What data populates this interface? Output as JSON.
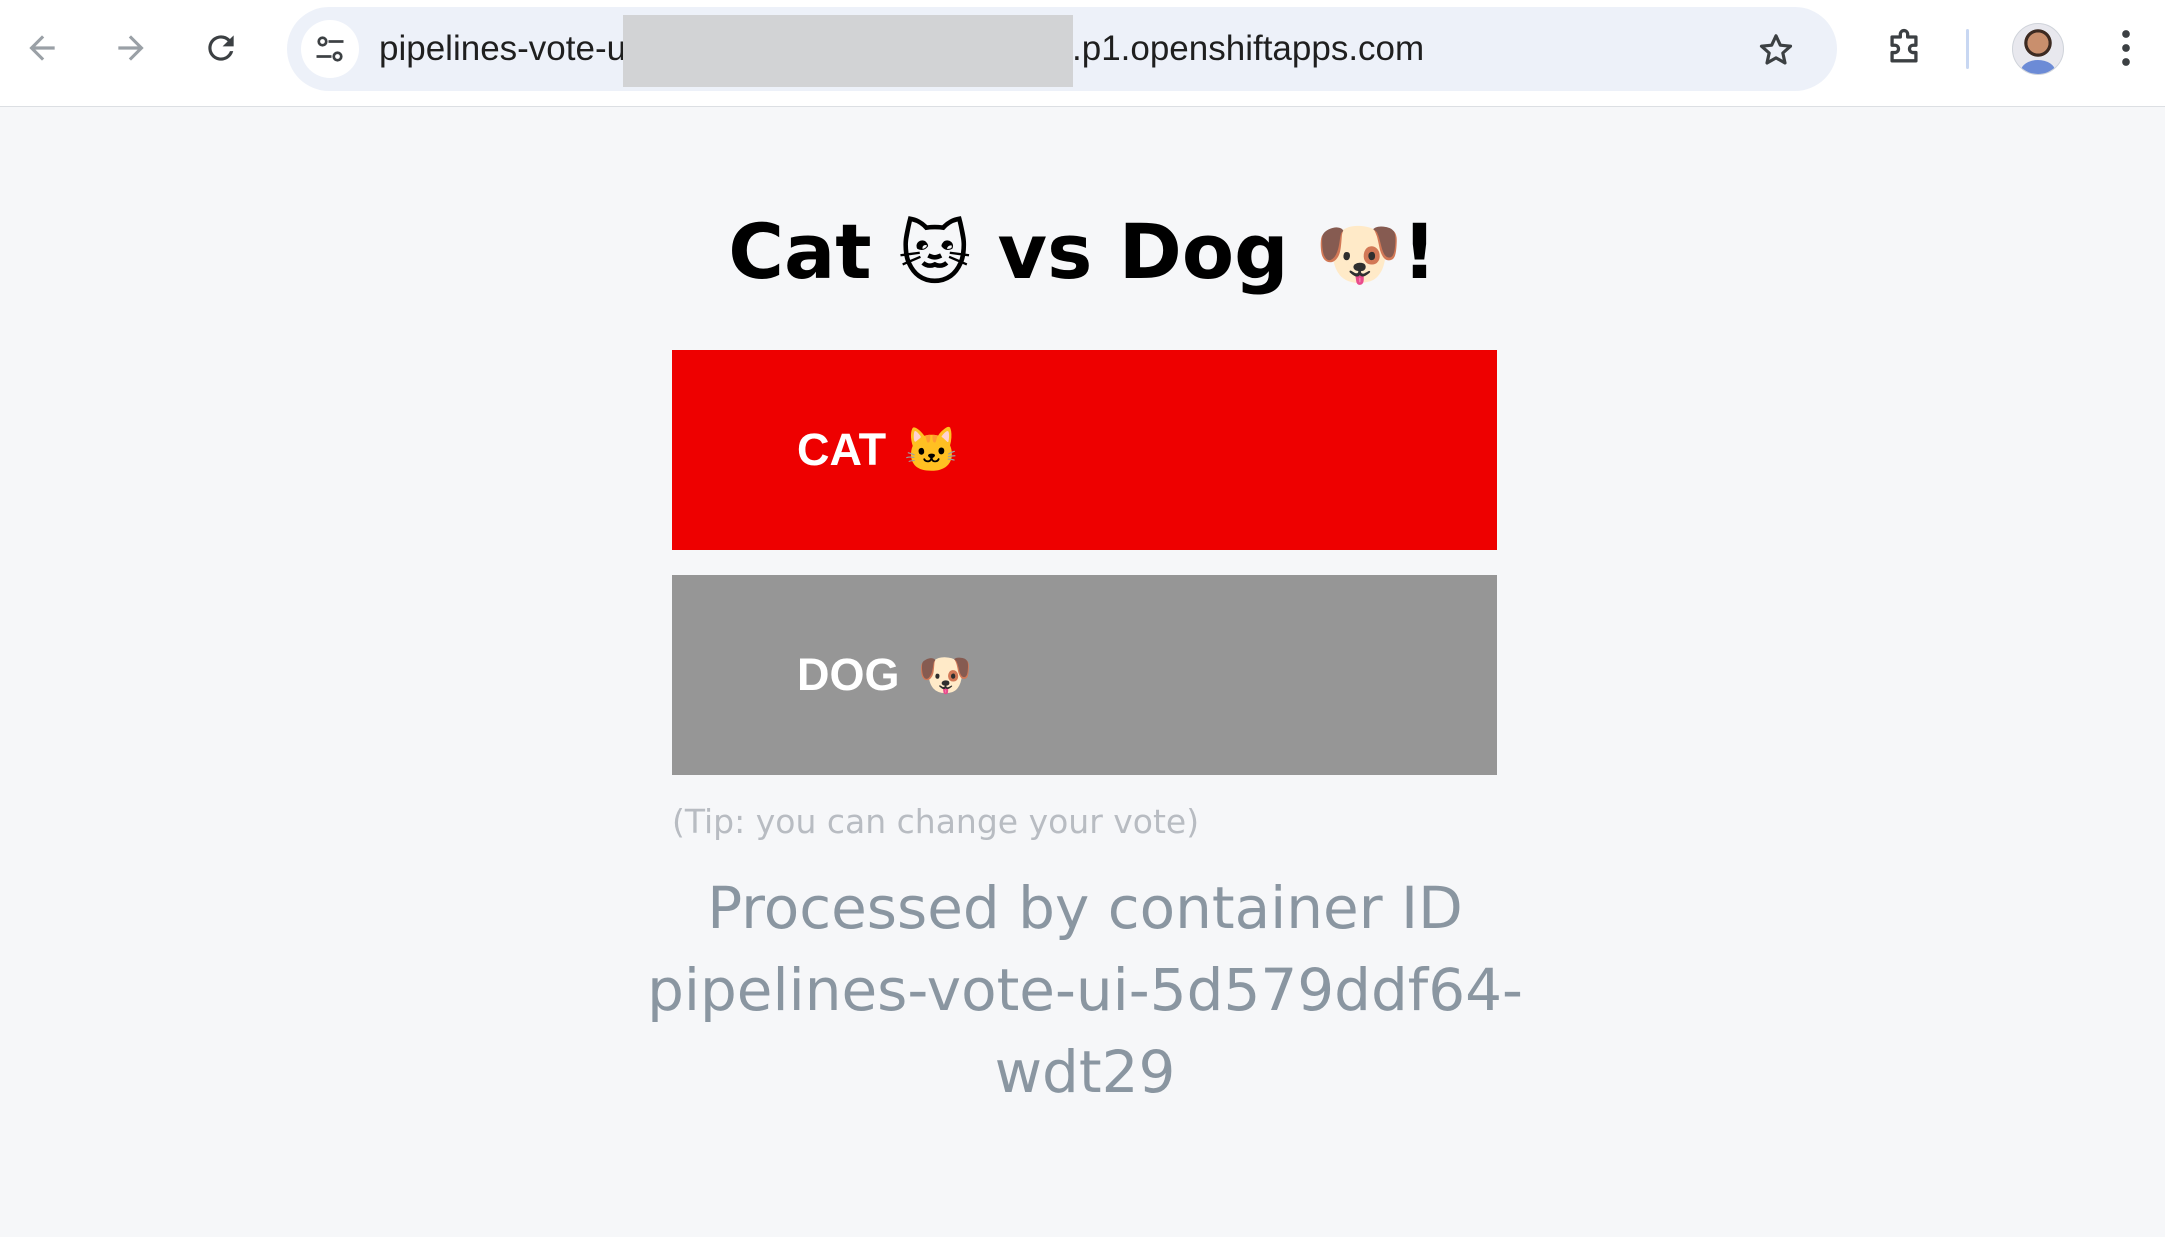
{
  "browser": {
    "url_prefix": "pipelines-vote-u",
    "url_suffix": ".p1.openshiftapps.com",
    "back_icon": "arrow-left-icon",
    "forward_icon": "arrow-right-icon",
    "reload_icon": "reload-icon",
    "site_info_icon": "tune-icon",
    "bookmark_icon": "star-icon",
    "extensions_icon": "puzzle-icon",
    "menu_icon": "kebab-menu-icon"
  },
  "page": {
    "title_part1": "Cat",
    "title_cat_emoji": "🐱",
    "title_part2": "vs Dog",
    "title_dog_emoji": "🐶",
    "title_end": "!",
    "cat_label": "CAT",
    "cat_emoji": "🐱",
    "dog_label": "DOG",
    "dog_emoji": "🐶",
    "tip": "(Tip: you can change your vote)",
    "processed_line1": "Processed by container ID",
    "processed_line2": "pipelines-vote-ui-5d579ddf64-wdt29"
  },
  "colors": {
    "cat_button": "#ee0000",
    "dog_button": "#969696",
    "page_background": "#f6f7f9"
  }
}
